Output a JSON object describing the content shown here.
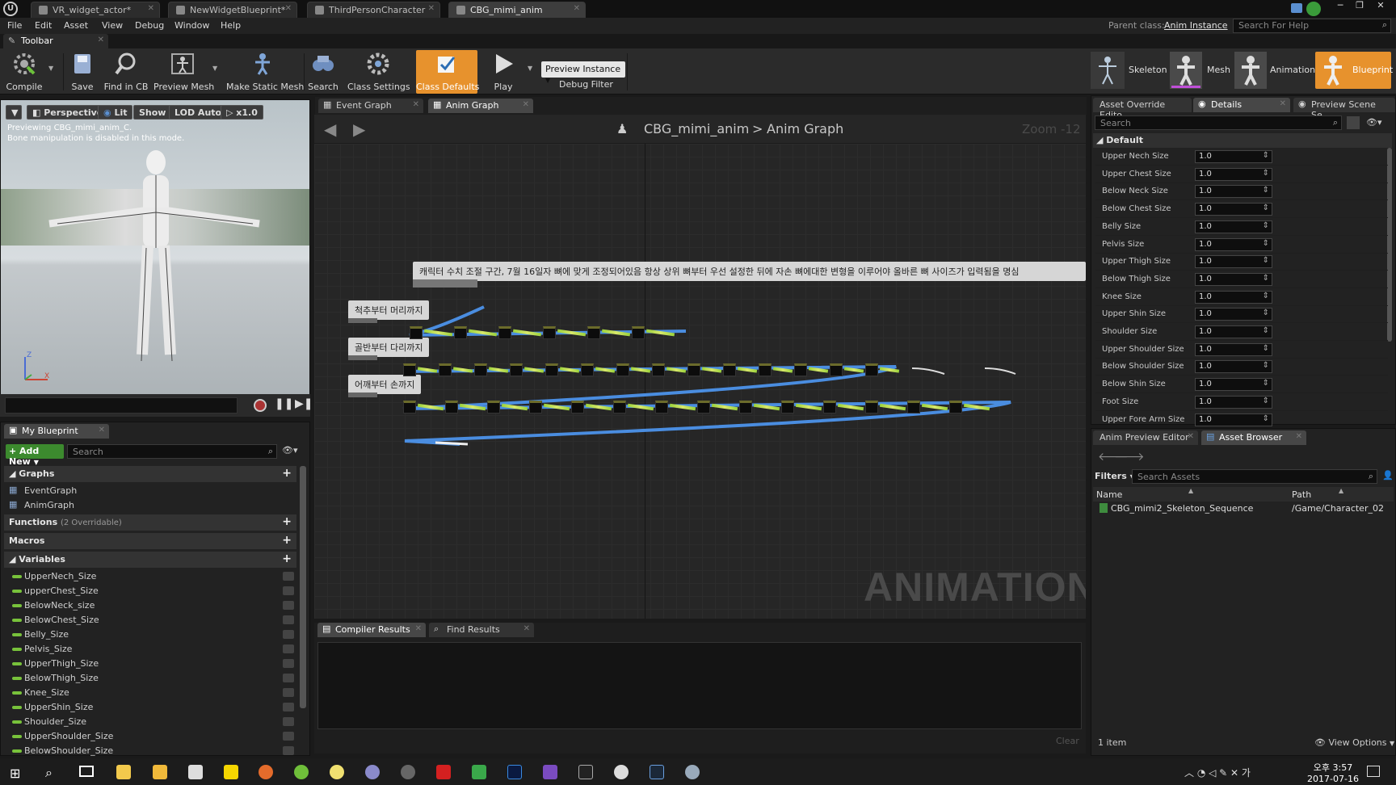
{
  "tabs": [
    {
      "label": "VR_widget_actor*"
    },
    {
      "label": "NewWidgetBlueprint*"
    },
    {
      "label": "ThirdPersonCharacter"
    },
    {
      "label": "CBG_mimi_anim"
    }
  ],
  "menu": [
    "File",
    "Edit",
    "Asset",
    "View",
    "Debug",
    "Window",
    "Help"
  ],
  "parent_class_label": "Parent class:",
  "parent_class_value": "Anim Instance",
  "help_search_placeholder": "Search For Help",
  "toolbar_tab": "Toolbar",
  "toolbar": {
    "compile": "Compile",
    "save": "Save",
    "find_in_cb": "Find in CB",
    "preview_mesh": "Preview Mesh",
    "make_static_mesh": "Make Static Mesh",
    "search": "Search",
    "class_settings": "Class Settings",
    "class_defaults": "Class Defaults",
    "play": "Play",
    "preview_instance": "Preview Instance",
    "debug_filter": "Debug Filter"
  },
  "modes": {
    "skeleton": "Skeleton",
    "mesh": "Mesh",
    "animation": "Animation",
    "blueprint": "Blueprint"
  },
  "viewport": {
    "perspective": "Perspective",
    "lit": "Lit",
    "show": "Show",
    "lod": "LOD Auto",
    "speed": "x1.0",
    "info1": "Previewing CBG_mimi_anim_C.",
    "info2": "Bone manipulation is disabled in this mode."
  },
  "graph_tabs": {
    "event": "Event Graph",
    "anim": "Anim Graph"
  },
  "breadcrumb": {
    "bp": "CBG_mimi_anim",
    "graph": "Anim Graph"
  },
  "zoom": "Zoom -12",
  "watermark": "ANIMATION",
  "comments": {
    "main": "캐릭터 수치 조절 구간, 7월 16일자 뼈에 맞게 조정되어있음 항상 상위 뼈부터 우선 설정한 뒤에 자손 뼈에대한 변형을 이루어야 올바른 뼈 사이즈가 입력됨을 명심",
    "c1": "척추부터 머리까지",
    "c2": "골반부터 다리까지",
    "c3": "어깨부터 손까지"
  },
  "bottom_tabs": {
    "compiler": "Compiler Results",
    "find": "Find Results",
    "clear": "Clear"
  },
  "my_blueprint": {
    "tab": "My Blueprint",
    "add_new": "Add New",
    "search_placeholder": "Search",
    "graphs": "Graphs",
    "event_graph": "EventGraph",
    "anim_graph": "AnimGraph",
    "functions": "Functions",
    "functions_note": "(2 Overridable)",
    "macros": "Macros",
    "variables": "Variables",
    "vars": [
      "UpperNech_Size",
      "upperChest_Size",
      "BelowNeck_size",
      "BelowChest_Size",
      "Belly_Size",
      "Pelvis_Size",
      "UpperThigh_Size",
      "BelowThigh_Size",
      "Knee_Size",
      "UpperShin_Size",
      "Shoulder_Size",
      "UpperShoulder_Size",
      "BelowShoulder_Size"
    ]
  },
  "details": {
    "tabs": {
      "override": "Asset Override Edito",
      "details": "Details",
      "preview": "Preview Scene Se"
    },
    "search_placeholder": "Search",
    "category": "Default",
    "rows": [
      {
        "name": "Upper Nech Size",
        "value": "1.0"
      },
      {
        "name": "Upper Chest Size",
        "value": "1.0"
      },
      {
        "name": "Below Neck Size",
        "value": "1.0"
      },
      {
        "name": "Below Chest Size",
        "value": "1.0"
      },
      {
        "name": "Belly Size",
        "value": "1.0"
      },
      {
        "name": "Pelvis Size",
        "value": "1.0"
      },
      {
        "name": "Upper Thigh Size",
        "value": "1.0"
      },
      {
        "name": "Below Thigh Size",
        "value": "1.0"
      },
      {
        "name": "Knee Size",
        "value": "1.0"
      },
      {
        "name": "Upper Shin Size",
        "value": "1.0"
      },
      {
        "name": "Shoulder Size",
        "value": "1.0"
      },
      {
        "name": "Upper Shoulder Size",
        "value": "1.0"
      },
      {
        "name": "Below Shoulder Size",
        "value": "1.0"
      },
      {
        "name": "Below Shin Size",
        "value": "1.0"
      },
      {
        "name": "Foot Size",
        "value": "1.0"
      },
      {
        "name": "Upper Fore Arm Size",
        "value": "1.0"
      }
    ]
  },
  "asset_browser": {
    "tabs": {
      "preview_editor": "Anim Preview Editor",
      "browser": "Asset Browser"
    },
    "filters": "Filters",
    "search_placeholder": "Search Assets",
    "col_name": "Name",
    "col_path": "Path",
    "items": [
      {
        "name": "CBG_mimi2_Skeleton_Sequence",
        "path": "/Game/Character_02"
      }
    ],
    "count": "1 item",
    "view_options": "View Options"
  },
  "clock": {
    "time": "오후 3:57",
    "date": "2017-07-16"
  }
}
